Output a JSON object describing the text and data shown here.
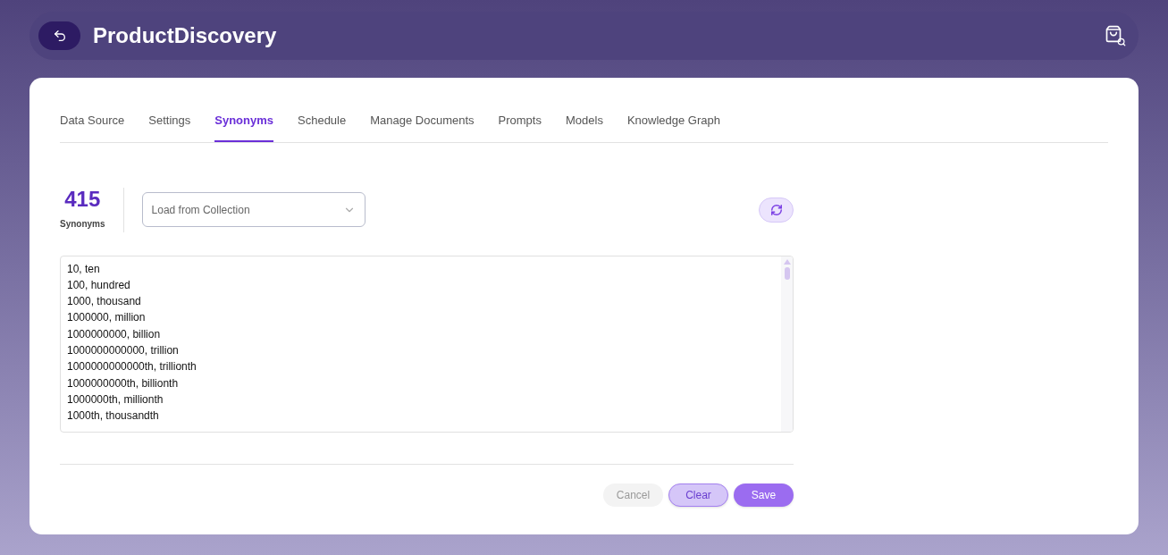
{
  "header": {
    "title": "ProductDiscovery"
  },
  "tabs": [
    {
      "label": "Data Source",
      "selected": false
    },
    {
      "label": "Settings",
      "selected": false
    },
    {
      "label": "Synonyms",
      "selected": true
    },
    {
      "label": "Schedule",
      "selected": false
    },
    {
      "label": "Manage Documents",
      "selected": false
    },
    {
      "label": "Prompts",
      "selected": false
    },
    {
      "label": "Models",
      "selected": false
    },
    {
      "label": "Knowledge Graph",
      "selected": false
    }
  ],
  "stat": {
    "value": "415",
    "label": "Synonyms"
  },
  "collection_select": {
    "placeholder": "Load from Collection"
  },
  "synonyms_text": [
    "10, ten",
    "100, hundred",
    "1000, thousand",
    "1000000, million",
    "1000000000, billion",
    "1000000000000, trillion",
    "1000000000000th, trillionth",
    "1000000000th, billionth",
    "1000000th, millionth",
    "1000th, thousandth"
  ],
  "buttons": [
    {
      "label": "Cancel",
      "kind": "plain",
      "disabled": true
    },
    {
      "label": "Clear",
      "kind": "secondary",
      "disabled": false
    },
    {
      "label": "Save",
      "kind": "primary",
      "disabled": false
    }
  ]
}
